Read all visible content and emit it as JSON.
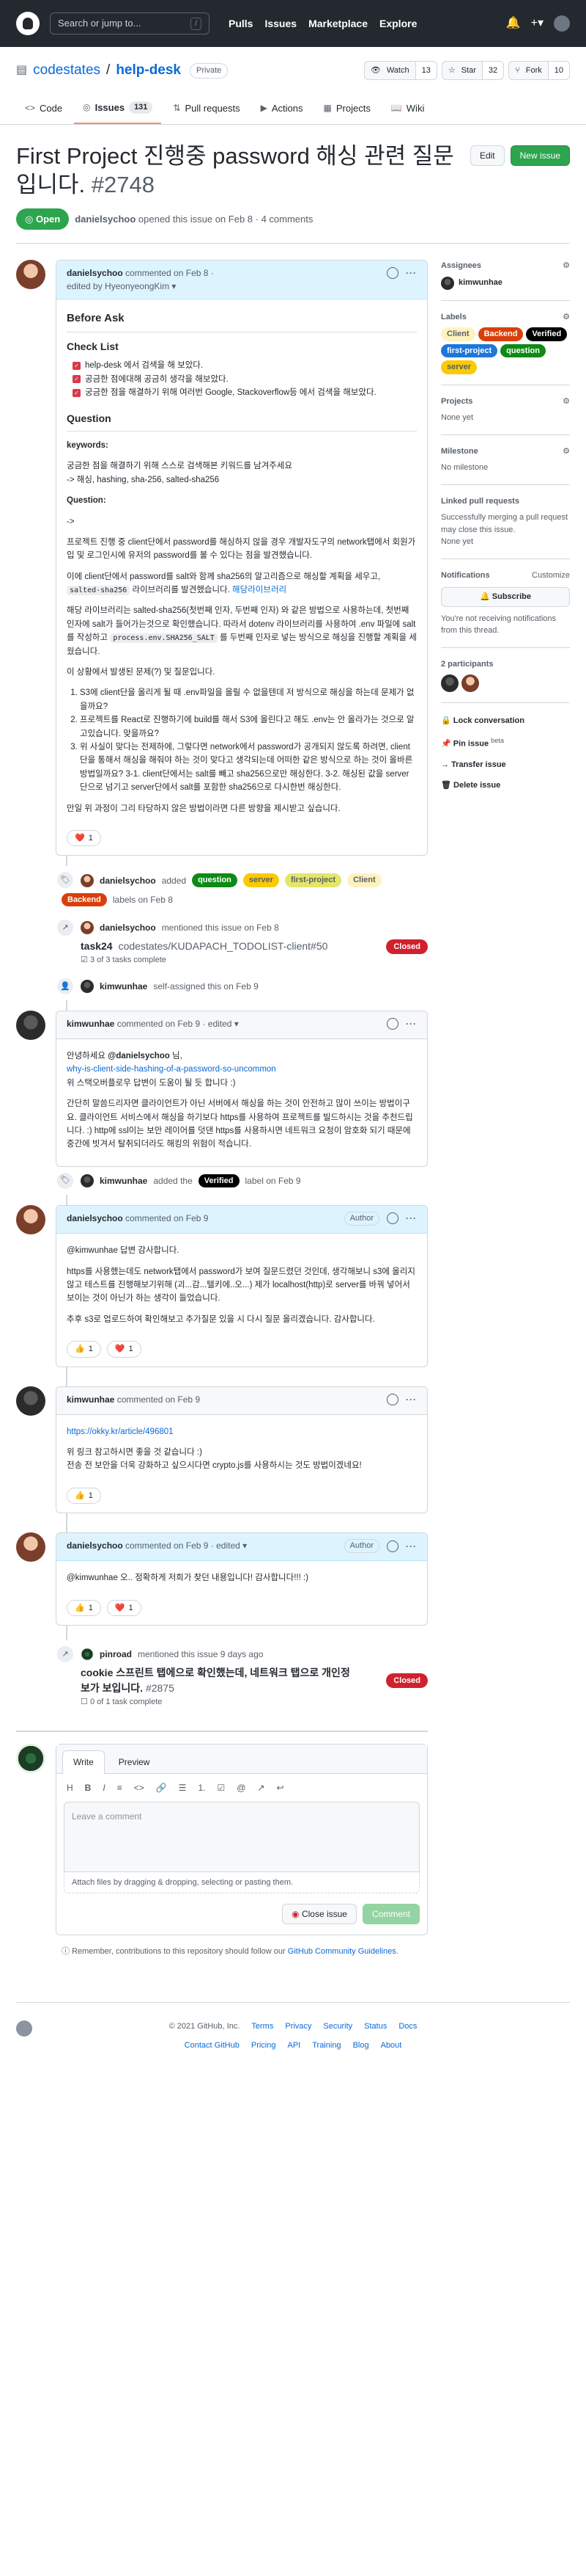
{
  "header": {
    "search_placeholder": "Search or jump to...",
    "slash_key": "/",
    "nav": [
      "Pulls",
      "Issues",
      "Marketplace",
      "Explore"
    ]
  },
  "repo": {
    "owner": "codestates",
    "separator": "/",
    "name": "help-desk",
    "visibility": "Private",
    "watch_label": "Watch",
    "watch_count": "13",
    "star_label": "Star",
    "star_count": "32",
    "fork_label": "Fork",
    "fork_count": "10"
  },
  "tabs": [
    {
      "label": "Code"
    },
    {
      "label": "Issues",
      "count": "131"
    },
    {
      "label": "Pull requests"
    },
    {
      "label": "Actions"
    },
    {
      "label": "Projects"
    },
    {
      "label": "Wiki"
    }
  ],
  "issue": {
    "title": "First Project 진행중 password 해싱 관련 질문입니다.",
    "number": "#2748",
    "edit_label": "Edit",
    "new_issue_label": "New issue",
    "state": "Open",
    "opened_by": "danielsychoo",
    "opened_text": "opened this issue on Feb 8 · 4 comments"
  },
  "comment1": {
    "author": "danielsychoo",
    "meta": "commented on Feb 8 ·",
    "edited": "edited by HyeonyeongKim",
    "h_before": "Before Ask",
    "h_checklist": "Check List",
    "checks": [
      "help-desk 에서 검색을 해 보았다.",
      "공금한 점에대해 공금히 생각을 해보았다.",
      "궁금한 점을 해결하기 위해 여러번 Google, Stackoverflow등 에서 검색을 해보았다."
    ],
    "h_question": "Question",
    "keywords_label": "keywords:",
    "keywords_p1": "궁금한 점을 해결하기 위해 스스로 검색해본 키워드를 남겨주세요",
    "keywords_p2": "-> 해싱, hashing, sha-256, salted-sha256",
    "question_label": "Question:",
    "arrow": "->",
    "p1": "프로젝트 진행 중 client단에서 password를 해싱하지 않을 경우 개발자도구의 network탭에서 회원가입 및 로그인시에 유저의 password를 볼 수 있다는 점을 발견했습니다.",
    "p2": "이에 client단에서 password를 salt와 함께 sha256의 알고리즘으로 해싱할 계획을 세우고,",
    "p2_code": "salted-sha256",
    "p2_mid": "라이브러리를 발견했습니다.",
    "p2_link": "해당라이브러리",
    "p3": "해당 라이브러리는 salted-sha256(첫번째 인자, 두번째 인자) 와 같은 방법으로 사용하는데, 첫번째 인자에 salt가 들어가는것으로 확인했습니다. 따라서 dotenv 라이브러리를 사용하여 .env 파일에 salt를 작성하고",
    "p3_code": "process.env.SHA256_SALT",
    "p3_end": "를 두번째 인자로 넣는 방식으로 해싱을 진행할 계획을 세웠습니다.",
    "p4": "이 상황에서 발생된 문제(?) 및 질문입니다.",
    "list": [
      "S3에 client단을 올리게 될 때 .env파일을 올릴 수 없을텐데 저 방식으로 해싱을 하는데 문제가 없을까요?",
      "프로젝트를 React로 진행하기에 build를 해서 S3에 올린다고 해도 .env는 안 올라가는 것으로 알고있습니다. 맞을까요?",
      "위 사실이 맞다는 전제하에, 그렇다면 network에서 password가 공개되지 않도록 하려면, client단을 통해서 해싱을 해줘야 하는 것이 맞다고 생각되는데 어떠한 같은 방식으로 하는 것이 올바른 방법일까요? 3-1. client단에서는 salt를 빼고 sha256으로만 해싱한다. 3-2. 해싱된 값을 server단으로 넘기고 server단에서 salt를 포함한 sha256으로 다시한번 해싱한다."
    ],
    "p5": "만일 위 과정이 그리 타당하지 않은 방법이라면 다른 방향을 제시받고 싶습니다.",
    "reaction_heart": "❤️",
    "reaction_count": "1"
  },
  "event_labels": {
    "actor": "danielsychoo",
    "verb": "added",
    "labels": [
      {
        "name": "question",
        "bg": "#0e8a16",
        "fg": "#ffffff"
      },
      {
        "name": "server",
        "bg": "#fbca04",
        "fg": "#24292f"
      },
      {
        "name": "first-project",
        "bg": "#e4e669",
        "fg": "#24292f"
      },
      {
        "name": "Client",
        "bg": "#fef2c0",
        "fg": "#24292f"
      },
      {
        "name": "Backend",
        "bg": "#d93f0b",
        "fg": "#ffffff"
      }
    ],
    "suffix": "labels on Feb 8"
  },
  "event_mention": {
    "actor": "danielsychoo",
    "text": "mentioned this issue on Feb 8",
    "ref_title": "task24",
    "ref_repo": "codestates/KUDAPACH_TODOLIST-client#50",
    "ref_state": "Closed",
    "ref_tasks": "3 of 3 tasks complete"
  },
  "event_assign": {
    "actor": "kimwunhae",
    "text": "self-assigned this on Feb 9"
  },
  "comment2": {
    "author": "kimwunhae",
    "meta": "commented on Feb 9 · edited",
    "l1a": "안녕하세요",
    "l1b": "@danielsychoo",
    "l1c": "님,",
    "link": "why-is-client-side-hashing-of-a-password-so-uncommon",
    "l2": "위 스택오버플로우 답변이 도움이 될 듯 합니다 :)",
    "p2": "간단히 말씀드리자면 클라이언트가 아닌 서버에서 해싱을 하는 것이 안전하고 많이 쓰이는 방법이구요. 클라이언트 서비스에서 해싱을 하기보다 https를 사용하여 프로젝트를 빌드하시는 것을 추천드립니다. :) http에 ssl이는 보안 레이어를 덧댄 https를 사용하시면 네트워크 요청이 암호화 되기 때문에 중간에 빗겨서 탈취되더라도 해킹의 위험이 적습니다."
  },
  "event_verified": {
    "actor": "kimwunhae",
    "verb": "added the",
    "label": "Verified",
    "suffix": "label on Feb 9"
  },
  "comment3": {
    "author": "danielsychoo",
    "meta": "commented on Feb 9",
    "role": "Author",
    "l1": "@kimwunhae 답변 감사합니다.",
    "p2": "https를 사용했는데도 network탭에서 password가 보여 질문드렸던 것인데, 생각해보니 s3에 올리지 않고 테스트를 진행해보기위해 (괴...감...텔키에..오...) 제가 localhost(http)로 server를 바꿔 넣어서 보이는 것이 아닌가 하는 생각이 들었습니다.",
    "p3": "추후 s3로 업로드하여 확인해보고 추가질문 있을 시 다시 질문 올리겠습니다. 감사합니다.",
    "r1": "👍",
    "r1c": "1",
    "r2": "❤️",
    "r2c": "1"
  },
  "comment4": {
    "author": "kimwunhae",
    "meta": "commented on Feb 9",
    "link": "https://okky.kr/article/496801",
    "l2": "위 링크 참고하시면 좋을 것 같습니다 :)",
    "l3": "전송 전 보안을 더욱 강화하고 싶으시다면 crypto.js를 사용하시는 것도 방법이겠네요!",
    "r1": "👍",
    "r1c": "1"
  },
  "comment5": {
    "author": "danielsychoo",
    "meta": "commented on Feb 9 · edited",
    "role": "Author",
    "l1": "@kimwunhae 오.. 정확하게 저희가 찾던 내용입니다! 감사합니다!!! :)",
    "r1": "👍",
    "r1c": "1",
    "r2": "❤️",
    "r2c": "1"
  },
  "event_pinroad": {
    "actor": "pinroad",
    "text": "mentioned this issue 9 days ago",
    "ref_title": "cookie 스프린트 탭에으로 확인했는데, 네트워크 탭으로 개인정보가 보입니다.",
    "ref_num": "#2875",
    "ref_state": "Closed",
    "ref_tasks": "0 of 1 task complete"
  },
  "editor": {
    "tab_write": "Write",
    "tab_preview": "Preview",
    "tools": [
      "H",
      "B",
      "I",
      "≡",
      "<>",
      "🔗",
      "☰",
      "1.",
      "☑",
      "@",
      "↗",
      "↩"
    ],
    "placeholder": "Leave a comment",
    "attach": "Attach files by dragging & dropping, selecting or pasting them.",
    "close_label": "Close issue",
    "comment_label": "Comment",
    "note_pre": "Remember, contributions to this repository should follow our",
    "note_link": "GitHub Community Guidelines",
    "note_end": "."
  },
  "sidebar": {
    "assignees_title": "Assignees",
    "assignee": "kimwunhae",
    "labels_title": "Labels",
    "labels": [
      {
        "name": "Client",
        "bg": "#fef2c0",
        "fg": "#24292f"
      },
      {
        "name": "Backend",
        "bg": "#d93f0b",
        "fg": "#ffffff"
      },
      {
        "name": "Verified",
        "bg": "#000000",
        "fg": "#ffffff"
      },
      {
        "name": "first-project",
        "bg": "#1d76db",
        "fg": "#ffffff"
      },
      {
        "name": "question",
        "bg": "#0e8a16",
        "fg": "#ffffff"
      },
      {
        "name": "server",
        "bg": "#fbca04",
        "fg": "#24292f"
      }
    ],
    "projects_title": "Projects",
    "projects_value": "None yet",
    "milestone_title": "Milestone",
    "milestone_value": "No milestone",
    "linked_title": "Linked pull requests",
    "linked_value": "Successfully merging a pull request may close this issue.",
    "linked_value2": "None yet",
    "notif_title": "Notifications",
    "notif_customize": "Customize",
    "subscribe": "Subscribe",
    "notif_note": "You're not receiving notifications from this thread.",
    "participants_title": "2 participants",
    "actions": [
      "Lock conversation",
      "Pin issue",
      "Transfer issue",
      "Delete issue"
    ],
    "pin_sup": "beta"
  },
  "footer": {
    "copyright": "© 2021 GitHub, Inc.",
    "row1": [
      "Terms",
      "Privacy",
      "Security",
      "Status",
      "Docs"
    ],
    "row2": [
      "Contact GitHub",
      "Pricing",
      "API",
      "Training",
      "Blog",
      "About"
    ]
  }
}
